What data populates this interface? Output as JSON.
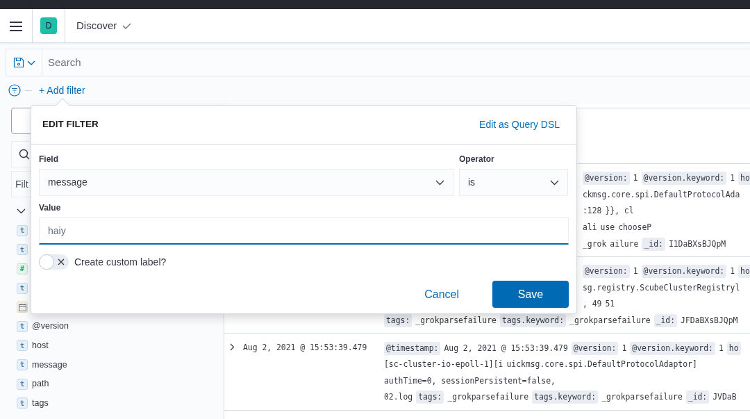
{
  "header": {
    "avatar": "D",
    "app_title": "Discover"
  },
  "query_bar": {
    "placeholder": "Search"
  },
  "filter_bar": {
    "add_filter": "+ Add filter"
  },
  "sidebar": {
    "filter_placeholder": "Filt",
    "fields": [
      {
        "kind": "string",
        "token": "t"
      },
      {
        "kind": "string",
        "token": "t"
      },
      {
        "kind": "number",
        "token": "#"
      },
      {
        "kind": "string",
        "token": "t"
      },
      {
        "kind": "date"
      },
      {
        "kind": "string",
        "token": "t",
        "name": "@version"
      },
      {
        "kind": "string",
        "token": "t",
        "name": "host"
      },
      {
        "kind": "string",
        "token": "t",
        "name": "message"
      },
      {
        "kind": "string",
        "token": "t",
        "name": "path"
      },
      {
        "kind": "string",
        "token": "t",
        "name": "tags"
      }
    ]
  },
  "documents": [
    {
      "lines": [
        {
          "covered": true,
          "segments": [
            {
              "kind": "key",
              "text": "@version:"
            },
            {
              "kind": "value",
              "text": "1"
            },
            {
              "kind": "key",
              "text": "@version.keyword:"
            },
            {
              "kind": "value",
              "text": "1"
            },
            {
              "kind": "key",
              "text": "ho"
            }
          ]
        },
        {
          "covered": true,
          "segments": [
            {
              "kind": "value",
              "text": "ckmsg.core.spi.DefaultProtocolAda"
            }
          ]
        },
        {
          "covered": true,
          "segments": [
            {
              "kind": "value",
              "text": ":128"
            },
            {
              "kind": "value",
              "text": "}}, cl"
            }
          ]
        },
        {
          "covered": true,
          "segments": [
            {
              "kind": "value",
              "text": "ali"
            },
            {
              "kind": "value",
              "text": "use"
            },
            {
              "kind": "value",
              "text": "chooseP"
            }
          ]
        },
        {
          "covered": true,
          "segments": [
            {
              "kind": "value",
              "text": "_grok"
            },
            {
              "kind": "value",
              "text": "ailure"
            },
            {
              "kind": "key",
              "text": "_id:"
            },
            {
              "kind": "value",
              "text": "I1DaBXsBJQpM"
            }
          ]
        }
      ]
    },
    {
      "lines": [
        {
          "covered": true,
          "segments": [
            {
              "kind": "key",
              "text": "@version:"
            },
            {
              "kind": "value",
              "text": "1"
            },
            {
              "kind": "key",
              "text": "@version.keyword:"
            },
            {
              "kind": "value",
              "text": "1"
            },
            {
              "kind": "key",
              "text": "ho"
            }
          ]
        },
        {
          "covered": true,
          "segments": [
            {
              "kind": "value",
              "text": "sg.registry.ScubeClusterRegistryl"
            }
          ]
        },
        {
          "covered": true,
          "segments": [
            {
              "kind": "value",
              "text": ", 49"
            },
            {
              "kind": "value",
              "text": "51"
            }
          ]
        },
        {
          "covered": false,
          "segments": [
            {
              "kind": "key",
              "text": "tags:"
            },
            {
              "kind": "value",
              "text": "_grokparsefailure"
            },
            {
              "kind": "key",
              "text": "tags.keyword:"
            },
            {
              "kind": "value",
              "text": "_grokparsefailure"
            },
            {
              "kind": "key",
              "text": "_id:"
            },
            {
              "kind": "value",
              "text": "JFDaBXsBJQpM"
            }
          ]
        }
      ]
    },
    {
      "time": "Aug 2, 2021 @ 15:53:39.479",
      "lines": [
        {
          "covered": false,
          "segments": [
            {
              "kind": "key",
              "text": "@timestamp:"
            },
            {
              "kind": "value",
              "text": "Aug 2, 2021 @ 15:53:39.479"
            },
            {
              "kind": "key",
              "text": "@version:"
            },
            {
              "kind": "value",
              "text": "1"
            },
            {
              "kind": "key",
              "text": "@version.keyword:"
            },
            {
              "kind": "value",
              "text": "1"
            },
            {
              "kind": "key",
              "text": "ho"
            }
          ]
        },
        {
          "covered": false,
          "segments": [
            {
              "kind": "value",
              "text": "[sc-cluster-io-epoll-1][i"
            },
            {
              "kind": "value",
              "text": "uickmsg.core.spi.DefaultProtocolAdaptor]"
            }
          ]
        },
        {
          "covered": false,
          "segments": [
            {
              "kind": "value",
              "text": "authTime=0, sessionPersistent=false,"
            }
          ]
        },
        {
          "covered": false,
          "segments": [
            {
              "kind": "value",
              "text": "02.log"
            },
            {
              "kind": "key",
              "text": "tags:"
            },
            {
              "kind": "value",
              "text": "_grokparsefailure"
            },
            {
              "kind": "key",
              "text": "tags.keyword:"
            },
            {
              "kind": "value",
              "text": "_grokparsefailure"
            },
            {
              "kind": "key",
              "text": "_id:"
            },
            {
              "kind": "value",
              "text": "JVDaB"
            }
          ]
        }
      ]
    }
  ],
  "edit_filter": {
    "title": "EDIT FILTER",
    "query_dsl_link": "Edit as Query DSL",
    "field": {
      "label": "Field",
      "value": "message"
    },
    "operator": {
      "label": "Operator",
      "value": "is"
    },
    "value": {
      "label": "Value",
      "value": "haiy"
    },
    "custom_label": {
      "label": "Create custom label?",
      "on": false
    },
    "cancel": "Cancel",
    "save": "Save"
  }
}
